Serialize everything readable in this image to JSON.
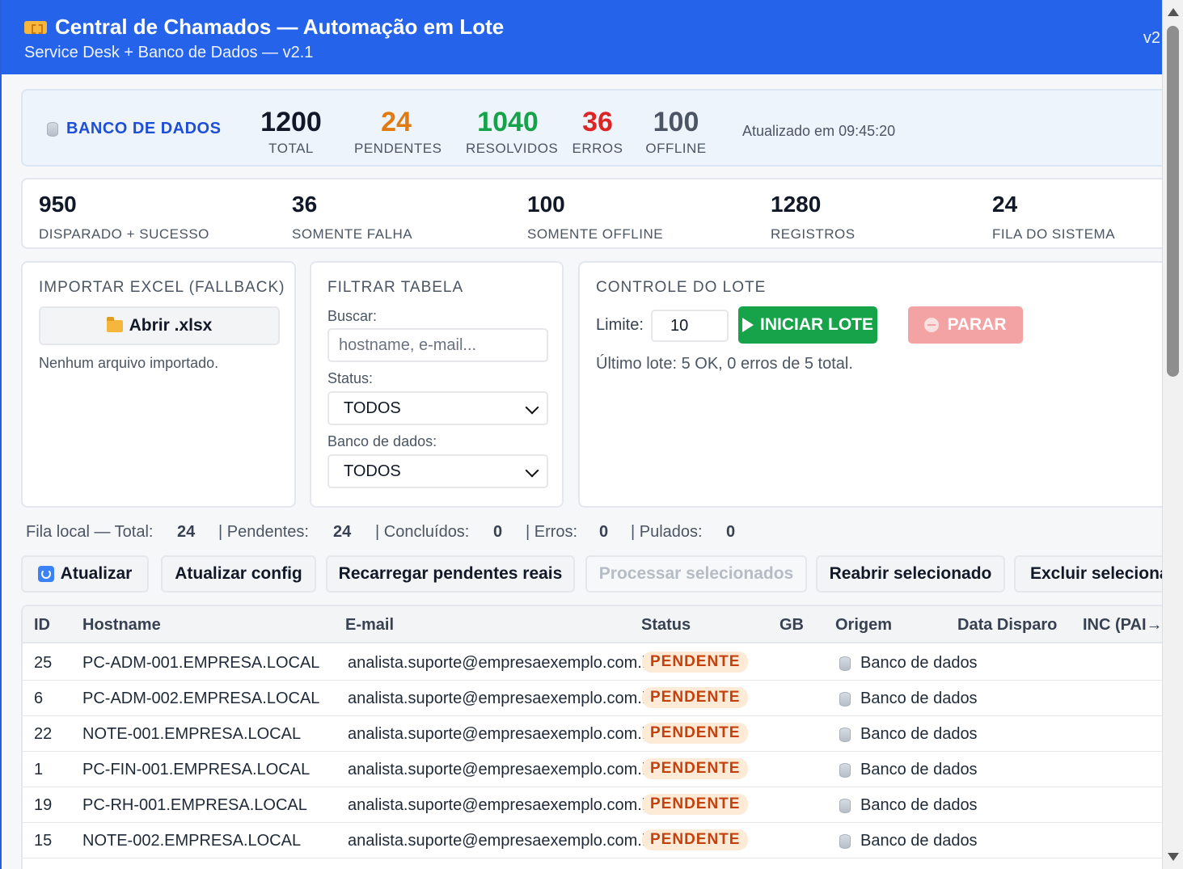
{
  "header": {
    "title": "Central de Chamados — Automação em Lote",
    "subtitle": "Service Desk + Banco de Dados — v2.1",
    "version_tag": "v2"
  },
  "db_bar": {
    "label": "BANCO DE DADOS",
    "stats": [
      {
        "value": "1200",
        "label": "TOTAL",
        "color": "#111827"
      },
      {
        "value": "24",
        "label": "PENDENTES",
        "color": "#e07b12"
      },
      {
        "value": "1040",
        "label": "RESOLVIDOS",
        "color": "#15a34a"
      },
      {
        "value": "36",
        "label": "ERROS",
        "color": "#dc2626"
      },
      {
        "value": "100",
        "label": "OFFLINE",
        "color": "#4b5563"
      }
    ],
    "updated": "Atualizado em 09:45:20"
  },
  "counts": [
    {
      "value": "950",
      "label": "DISPARADO + SUCESSO"
    },
    {
      "value": "36",
      "label": "SOMENTE FALHA"
    },
    {
      "value": "100",
      "label": "SOMENTE OFFLINE"
    },
    {
      "value": "1280",
      "label": "REGISTROS"
    },
    {
      "value": "24",
      "label": "FILA DO SISTEMA"
    }
  ],
  "import": {
    "title": "IMPORTAR EXCEL (FALLBACK)",
    "button": "Abrir .xlsx",
    "note": "Nenhum arquivo importado."
  },
  "filter": {
    "title": "FILTRAR TABELA",
    "search_label": "Buscar:",
    "search_placeholder": "hostname, e-mail...",
    "status_label": "Status:",
    "status_value": "TODOS",
    "db_label": "Banco de dados:",
    "db_value": "TODOS"
  },
  "control": {
    "title": "CONTROLE DO LOTE",
    "limit_label": "Limite:",
    "limit_value": "10",
    "start_button": "INICIAR LOTE",
    "stop_button": "PARAR",
    "last_batch": "Último lote: 5 OK, 0 erros de 5 total."
  },
  "queue": {
    "total_label": "Fila local — Total:",
    "total": "24",
    "pending_label": "| Pendentes:",
    "pending": "24",
    "done_label": "| Concluídos:",
    "done": "0",
    "errors_label": "| Erros:",
    "errors": "0",
    "skipped_label": "| Pulados:",
    "skipped": "0"
  },
  "toolbar": {
    "refresh": "Atualizar",
    "refresh_config": "Atualizar config",
    "reload_pending": "Recarregar pendentes reais",
    "process_selected": "Processar selecionados",
    "reopen_selected": "Reabrir selecionado",
    "delete_selected": "Excluir selecionado"
  },
  "table": {
    "columns": [
      "ID",
      "Hostname",
      "E-mail",
      "Status",
      "GB",
      "Origem",
      "Data Disparo",
      "INC (PAI→FILHO)"
    ],
    "rows": [
      {
        "id": "25",
        "hostname": "PC-ADM-001.EMPRESA.LOCAL",
        "email": "analista.suporte@empresaexemplo.com.br",
        "status": "PENDENTE",
        "gb": "",
        "origin": "Banco de dados"
      },
      {
        "id": "6",
        "hostname": "PC-ADM-002.EMPRESA.LOCAL",
        "email": "analista.suporte@empresaexemplo.com.br",
        "status": "PENDENTE",
        "gb": "",
        "origin": "Banco de dados"
      },
      {
        "id": "22",
        "hostname": "NOTE-001.EMPRESA.LOCAL",
        "email": "analista.suporte@empresaexemplo.com.br",
        "status": "PENDENTE",
        "gb": "",
        "origin": "Banco de dados"
      },
      {
        "id": "1",
        "hostname": "PC-FIN-001.EMPRESA.LOCAL",
        "email": "analista.suporte@empresaexemplo.com.br",
        "status": "PENDENTE",
        "gb": "",
        "origin": "Banco de dados"
      },
      {
        "id": "19",
        "hostname": "PC-RH-001.EMPRESA.LOCAL",
        "email": "analista.suporte@empresaexemplo.com.br",
        "status": "PENDENTE",
        "gb": "",
        "origin": "Banco de dados"
      },
      {
        "id": "15",
        "hostname": "NOTE-002.EMPRESA.LOCAL",
        "email": "analista.suporte@empresaexemplo.com.br",
        "status": "PENDENTE",
        "gb": "",
        "origin": "Banco de dados"
      }
    ]
  },
  "icons": {
    "title": "ticket-icon",
    "db": "database-icon",
    "open": "folder-icon",
    "refresh": "refresh-icon",
    "start": "play-icon",
    "stop": "stop-icon",
    "origin": "database-icon"
  }
}
